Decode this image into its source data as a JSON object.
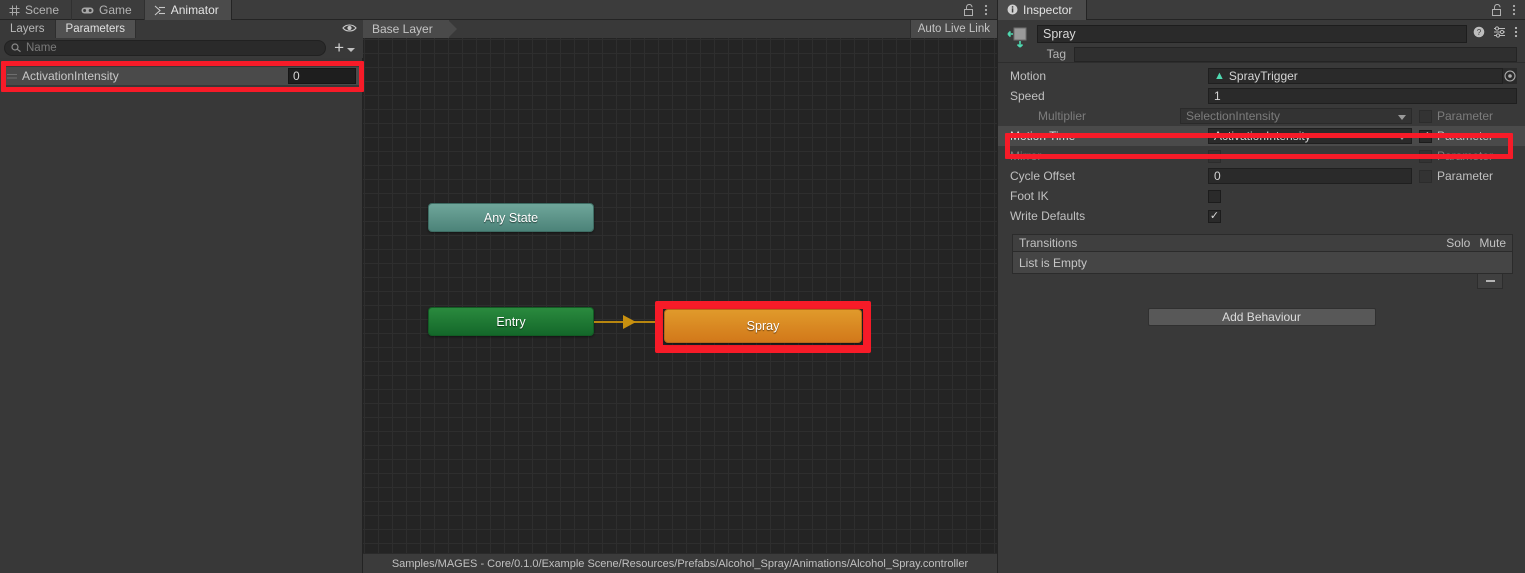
{
  "animator_window": {
    "tabs": [
      {
        "label": "Scene",
        "icon": "grid-icon",
        "active": false
      },
      {
        "label": "Game",
        "icon": "gamepad-icon",
        "active": false
      },
      {
        "label": "Animator",
        "icon": "animator-icon",
        "active": true
      }
    ],
    "window_controls": {
      "lock_icon": "lock-icon",
      "menu_icon": "kebab-menu-icon"
    },
    "left_panel": {
      "tabs": [
        {
          "label": "Layers",
          "active": false
        },
        {
          "label": "Parameters",
          "active": true
        }
      ],
      "eye_icon": "eye-icon",
      "search": {
        "placeholder": "Name",
        "value": "",
        "icon": "search-icon"
      },
      "add_button": {
        "label": "+",
        "icon": "plus-icon",
        "caret": "chevron-down-icon"
      },
      "parameters": [
        {
          "name": "ActivationIntensity",
          "value": "0",
          "highlighted": true
        }
      ]
    },
    "graph_toolbar": {
      "breadcrumb": "Base Layer",
      "auto_live_link": "Auto Live Link"
    },
    "graph": {
      "nodes": [
        {
          "id": "any-state",
          "label": "Any State",
          "type": "any-state"
        },
        {
          "id": "entry",
          "label": "Entry",
          "type": "entry"
        },
        {
          "id": "spray",
          "label": "Spray",
          "type": "state",
          "highlighted": true
        }
      ],
      "transitions": [
        {
          "from": "entry",
          "to": "spray"
        }
      ]
    },
    "footer_path": "Samples/MAGES - Core/0.1.0/Example Scene/Resources/Prefabs/Alcohol_Spray/Animations/Alcohol_Spray.controller"
  },
  "inspector": {
    "tab": {
      "label": "Inspector",
      "icon": "info-icon"
    },
    "window_controls": {
      "lock_icon": "lock-icon",
      "menu_icon": "kebab-menu-icon"
    },
    "header": {
      "object_icon": "animator-state-icon",
      "name": "Spray",
      "tag_label": "Tag",
      "tag_value": "",
      "help_icon": "help-icon",
      "preset_icon": "preset-icon",
      "menu_icon": "kebab-menu-icon"
    },
    "properties": [
      {
        "label": "Motion",
        "field_kind": "object",
        "value": "SprayTrigger",
        "object_icon": "animation-clip-icon",
        "picker_icon": "target-picker-icon",
        "has_parameter": false,
        "dimmed": false
      },
      {
        "label": "Speed",
        "field_kind": "text",
        "value": "1",
        "has_parameter": false,
        "dimmed": false
      },
      {
        "label": "Multiplier",
        "field_kind": "popup",
        "value": "SelectionIntensity",
        "has_parameter": true,
        "parameter_label": "Parameter",
        "parameter_checked": false,
        "dimmed": true
      },
      {
        "label": "Motion Time",
        "field_kind": "popup",
        "value": "ActivationIntensity",
        "has_parameter": true,
        "parameter_label": "Parameter",
        "parameter_checked": true,
        "dimmed": false,
        "selected": true,
        "highlighted": true
      },
      {
        "label": "Mirror",
        "field_kind": "checkbox",
        "value": "",
        "checked": false,
        "has_parameter": true,
        "parameter_label": "Parameter",
        "parameter_checked": false,
        "dimmed": true
      },
      {
        "label": "Cycle Offset",
        "field_kind": "text",
        "value": "0",
        "has_parameter": true,
        "parameter_label": "Parameter",
        "parameter_checked": false,
        "dimmed": false
      },
      {
        "label": "Foot IK",
        "field_kind": "checkbox",
        "value": "",
        "checked": false,
        "has_parameter": false,
        "dimmed": false
      },
      {
        "label": "Write Defaults",
        "field_kind": "checkbox",
        "value": "",
        "checked": true,
        "has_parameter": false,
        "dimmed": false
      }
    ],
    "transitions": {
      "header": "Transitions",
      "solo": "Solo",
      "mute": "Mute",
      "empty_text": "List is Empty",
      "remove_button": "-"
    },
    "add_behaviour_label": "Add Behaviour"
  }
}
